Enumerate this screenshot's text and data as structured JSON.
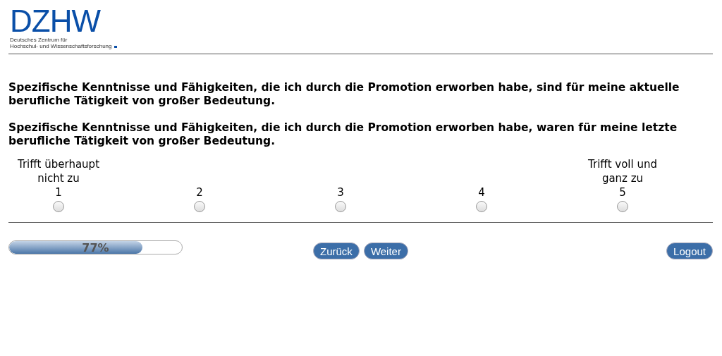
{
  "logo": {
    "wordmark": "DZHW",
    "subtitle_lines": [
      "Deutsches Zentrum für",
      "Hochschul- und Wissenschaftsforschung"
    ]
  },
  "questions": [
    "Spezifische Kenntnisse und Fähigkeiten, die ich durch die Promotion erworben habe, sind für meine aktuelle berufliche Tätigkeit von großer Bedeutung.",
    "Spezifische Kenntnisse und Fähigkeiten, die ich durch die Promotion erworben habe, waren für meine letzte berufliche Tätigkeit von großer Bedeutung."
  ],
  "scale": [
    {
      "anchor": "Trifft überhaupt nicht zu",
      "value": "1",
      "selected": false
    },
    {
      "value": "2",
      "selected": false
    },
    {
      "value": "3",
      "selected": false
    },
    {
      "value": "4",
      "selected": false
    },
    {
      "anchor": "Trifft voll und ganz zu",
      "value": "5",
      "selected": false
    }
  ],
  "progress": {
    "level": 0.77,
    "label": "77%"
  },
  "buttons": [
    "Zurück",
    "Weiter"
  ],
  "logout": "Logout"
}
